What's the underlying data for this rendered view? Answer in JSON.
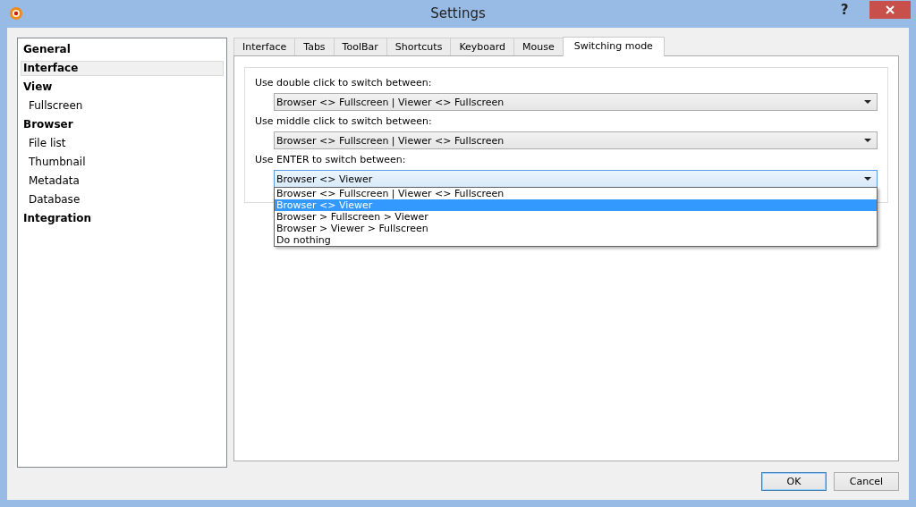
{
  "window": {
    "title": "Settings",
    "help": "?"
  },
  "sidebar": {
    "items": [
      {
        "label": "General",
        "selected": false
      },
      {
        "label": "Interface",
        "selected": true
      },
      {
        "label": "View",
        "selected": false,
        "children": [
          {
            "label": "Fullscreen",
            "selected": false
          }
        ]
      },
      {
        "label": "Browser",
        "selected": false,
        "children": [
          {
            "label": "File list",
            "selected": false
          },
          {
            "label": "Thumbnail",
            "selected": false
          },
          {
            "label": "Metadata",
            "selected": false
          },
          {
            "label": "Database",
            "selected": false
          }
        ]
      },
      {
        "label": "Integration",
        "selected": false
      }
    ]
  },
  "tabs": [
    {
      "label": "Interface",
      "selected": false
    },
    {
      "label": "Tabs",
      "selected": false
    },
    {
      "label": "ToolBar",
      "selected": false
    },
    {
      "label": "Shortcuts",
      "selected": false
    },
    {
      "label": "Keyboard",
      "selected": false
    },
    {
      "label": "Mouse",
      "selected": false
    },
    {
      "label": "Switching mode",
      "selected": true
    }
  ],
  "settings": [
    {
      "label": "Use double click to switch between:",
      "value": "Browser <> Fullscreen | Viewer <> Fullscreen",
      "open": false
    },
    {
      "label": "Use middle click to switch between:",
      "value": "Browser <> Fullscreen | Viewer <> Fullscreen",
      "open": false
    },
    {
      "label": "Use ENTER to switch between:",
      "value": "Browser <> Viewer",
      "open": true,
      "options": [
        {
          "label": "Browser <> Fullscreen | Viewer <> Fullscreen",
          "selected": false
        },
        {
          "label": "Browser <> Viewer",
          "selected": true
        },
        {
          "label": "Browser > Fullscreen > Viewer",
          "selected": false
        },
        {
          "label": "Browser > Viewer > Fullscreen",
          "selected": false
        },
        {
          "label": "Do nothing",
          "selected": false
        }
      ]
    }
  ],
  "buttons": [
    {
      "label": "OK",
      "default": true
    },
    {
      "label": "Cancel",
      "default": false
    }
  ]
}
